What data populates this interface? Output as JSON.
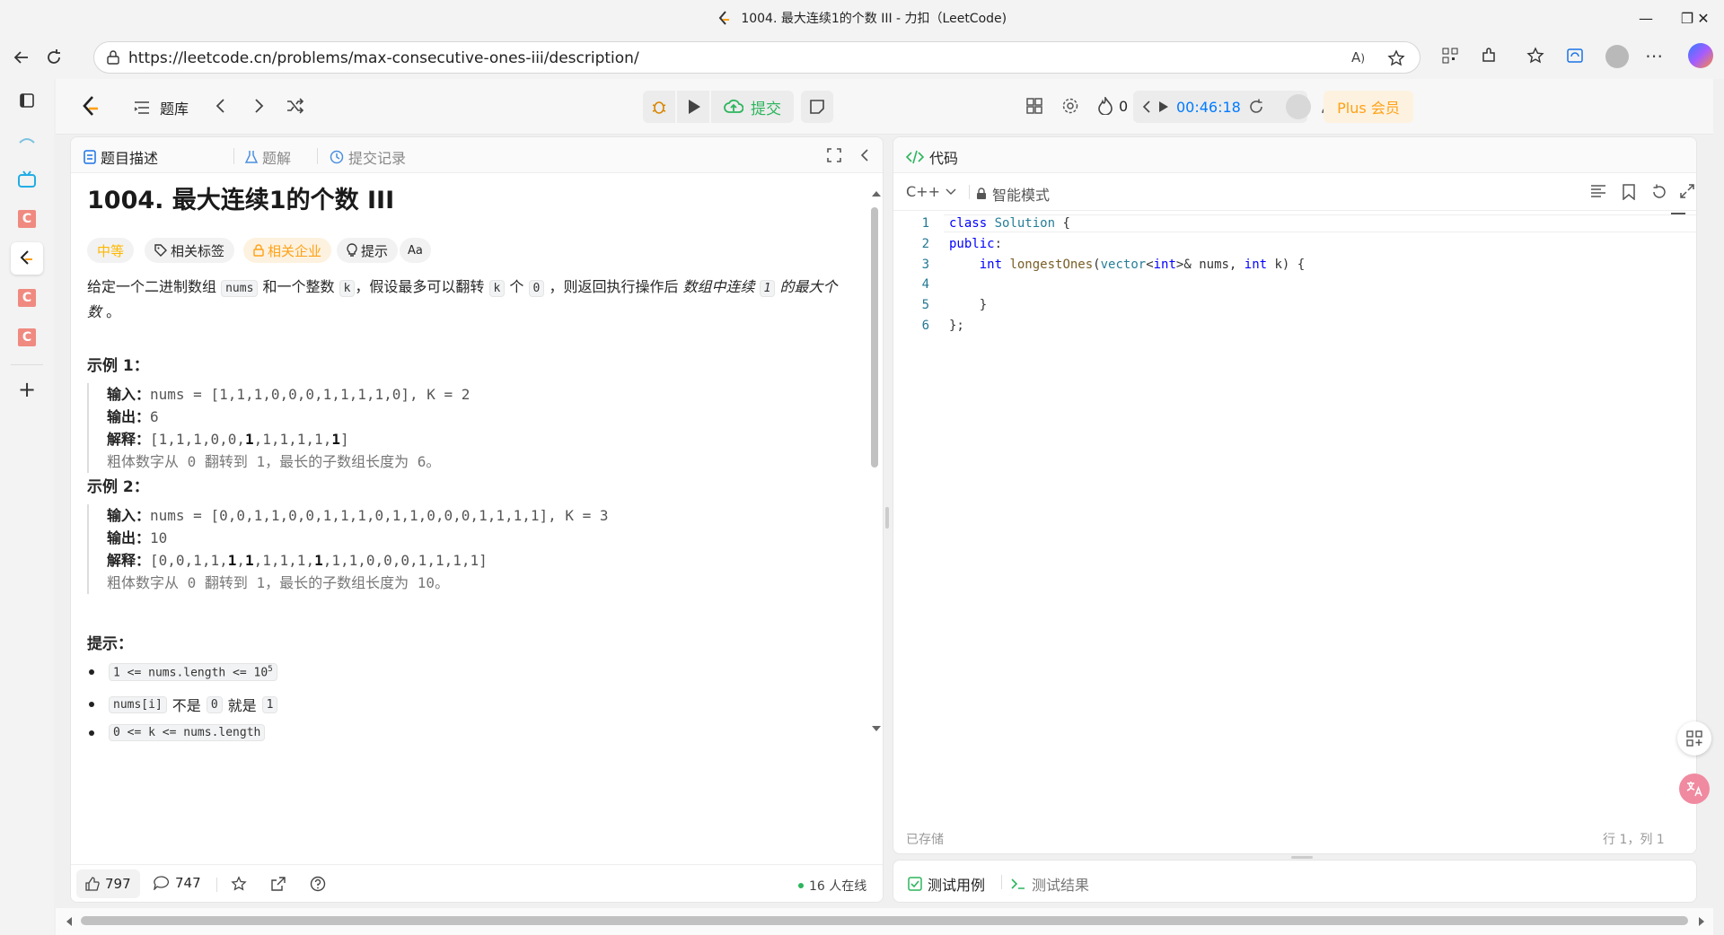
{
  "window": {
    "title": "1004. 最大连续1的个数 III - 力扣（LeetCode)",
    "url": "https://leetcode.cn/problems/max-consecutive-ones-iii/description/"
  },
  "toolbar": {
    "problem_bank": "题库",
    "submit": "提交",
    "fire_count": "0",
    "timer": "00:46:18",
    "plus": "Plus 会员"
  },
  "left_tabs": {
    "description": "题目描述",
    "solutions": "题解",
    "submissions": "提交记录"
  },
  "problem": {
    "title": "1004. 最大连续1的个数 III",
    "chips": {
      "difficulty": "中等",
      "tags": "相关标签",
      "companies": "相关企业",
      "hint": "提示",
      "translate": "Aa"
    },
    "desc_1": "给定一个二进制数组 ",
    "desc_nums": "nums",
    "desc_2": " 和一个整数 ",
    "desc_k": "k",
    "desc_3": "，假设最多可以翻转 ",
    "desc_k2": "k",
    "desc_4": " 个 ",
    "desc_zero": "0",
    "desc_5": " ，则返回执行操作后 ",
    "desc_em1": "数组中连续 ",
    "desc_one": "1",
    "desc_em2": " 的最大个数",
    "desc_6": " 。",
    "example1_title": "示例 1：",
    "example1": {
      "input_label": "输入：",
      "input": "nums = [1,1,1,0,0,0,1,1,1,1,0], K = 2",
      "output_label": "输出：",
      "output": "6",
      "explain_label": "解释：",
      "explain_pre": "[1,1,1,0,0,",
      "explain_b1": "1",
      "explain_mid": ",1,1,1,1,",
      "explain_b2": "1",
      "explain_post": "]",
      "note": "粗体数字从 0 翻转到 1，最长的子数组长度为 6。"
    },
    "example2_title": "示例 2：",
    "example2": {
      "input_label": "输入：",
      "input": "nums = [0,0,1,1,0,0,1,1,1,0,1,1,0,0,0,1,1,1,1], K = 3",
      "output_label": "输出：",
      "output": "10",
      "explain_label": "解释：",
      "e_a": "[0,0,1,1,",
      "e_b1": "1",
      "e_c": ",",
      "e_b2": "1",
      "e_d": ",1,1,1,",
      "e_b3": "1",
      "e_e": ",1,1,0,0,0,1,1,1,1]",
      "note": "粗体数字从 0 翻转到 1，最长的子数组长度为 10。"
    },
    "hints_title": "提示：",
    "hint1": "1 <= nums.length <= 10",
    "hint1_sup": "5",
    "hint2_code": "nums[i]",
    "hint2_text1": "不是",
    "hint2_zero": "0",
    "hint2_text2": "就是",
    "hint2_one": "1",
    "hint3": "0 <= k <= nums.length"
  },
  "left_bottom": {
    "likes": "797",
    "comments": "747",
    "online": "16 人在线"
  },
  "code": {
    "header": "代码",
    "language": "C++",
    "mode": "智能模式",
    "saved": "已存储",
    "position": "行 1，列 1",
    "line_numbers": [
      "1",
      "2",
      "3",
      "4",
      "5",
      "6"
    ]
  },
  "tests": {
    "cases": "测试用例",
    "results": "测试结果"
  },
  "colors": {
    "brand": "#ffa116",
    "green": "#2db55d",
    "blue_timer": "#007aff"
  }
}
